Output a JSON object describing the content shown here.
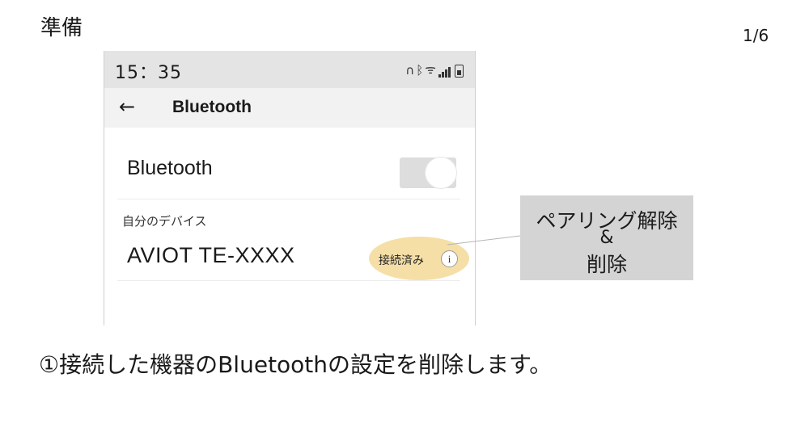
{
  "slide": {
    "title": "準備",
    "page": "1/6"
  },
  "phone": {
    "status_time": "15：35",
    "status_icons": [
      "headphones-icon",
      "bluetooth-icon",
      "wifi-icon",
      "signal-icon",
      "battery-icon"
    ],
    "header": {
      "back_arrow": "←",
      "title": "Bluetooth"
    },
    "bluetooth_toggle": {
      "label": "Bluetooth",
      "on": true
    },
    "my_devices_label": "自分のデバイス",
    "device": {
      "name": "AVIOT TE-XXXX",
      "status": "接続済み",
      "info": "i",
      "highlight": "#f5dfa6"
    }
  },
  "callout": {
    "line1": "ペアリング解除",
    "line2": "&",
    "line3": "削除"
  },
  "caption": "①接続した機器のBluetoothの設定を削除します。"
}
